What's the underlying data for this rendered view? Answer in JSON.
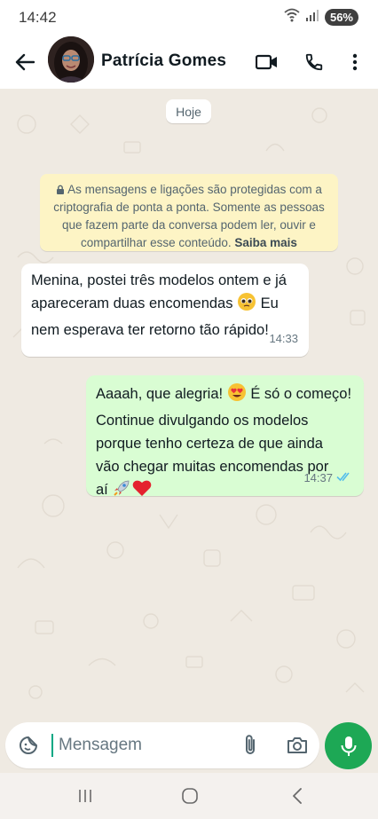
{
  "status_bar": {
    "time": "14:42",
    "battery": "56%",
    "icons": [
      "wifi-icon",
      "signal-icon",
      "battery-icon"
    ]
  },
  "header": {
    "contact_name": "Patrícia Gomes",
    "icons": [
      "back-arrow-icon",
      "avatar",
      "video-call-icon",
      "phone-icon",
      "more-vert-icon"
    ]
  },
  "chat": {
    "date_chip": "Hoje",
    "encryption_notice": {
      "text": "As mensagens e ligações são protegidas com a criptografia de ponta a ponta. Somente as pessoas que fazem parte da conversa podem ler, ouvir e compartilhar esse conteúdo.",
      "link": "Saiba mais"
    },
    "messages": [
      {
        "direction": "incoming",
        "text_part1": "Menina, postei três modelos ontem e já\napareceram duas encomendas",
        "emoji": "pleading-face-emoji",
        "text_part2": "Eu\nnem esperava ter retorno tão rápido!",
        "time": "14:33"
      },
      {
        "direction": "outgoing",
        "text_part1": "Aaaah, que alegria!",
        "emoji": "heart-eyes-emoji",
        "text_part2": "É só o começo!\nContinue divulgando os modelos\nporque tenho certeza de que ainda\nvão chegar muitas encomendas por\naí",
        "emojis_end": [
          "rocket-emoji",
          "red-heart-emoji"
        ],
        "time": "14:37",
        "status": "read"
      }
    ]
  },
  "input": {
    "placeholder": "Mensagem",
    "value": "",
    "icons": [
      "sticker-icon",
      "attach-icon",
      "camera-icon",
      "mic-icon"
    ]
  },
  "nav": {
    "icons": [
      "recents-icon",
      "home-icon",
      "back-icon"
    ]
  },
  "colors": {
    "accent": "#1da855",
    "outgoing_bubble": "#d9fdd3",
    "incoming_bubble": "#ffffff",
    "chat_bg": "#efeae2",
    "notice_bg": "#fdf4c5",
    "read_ticks": "#53bdeb"
  }
}
